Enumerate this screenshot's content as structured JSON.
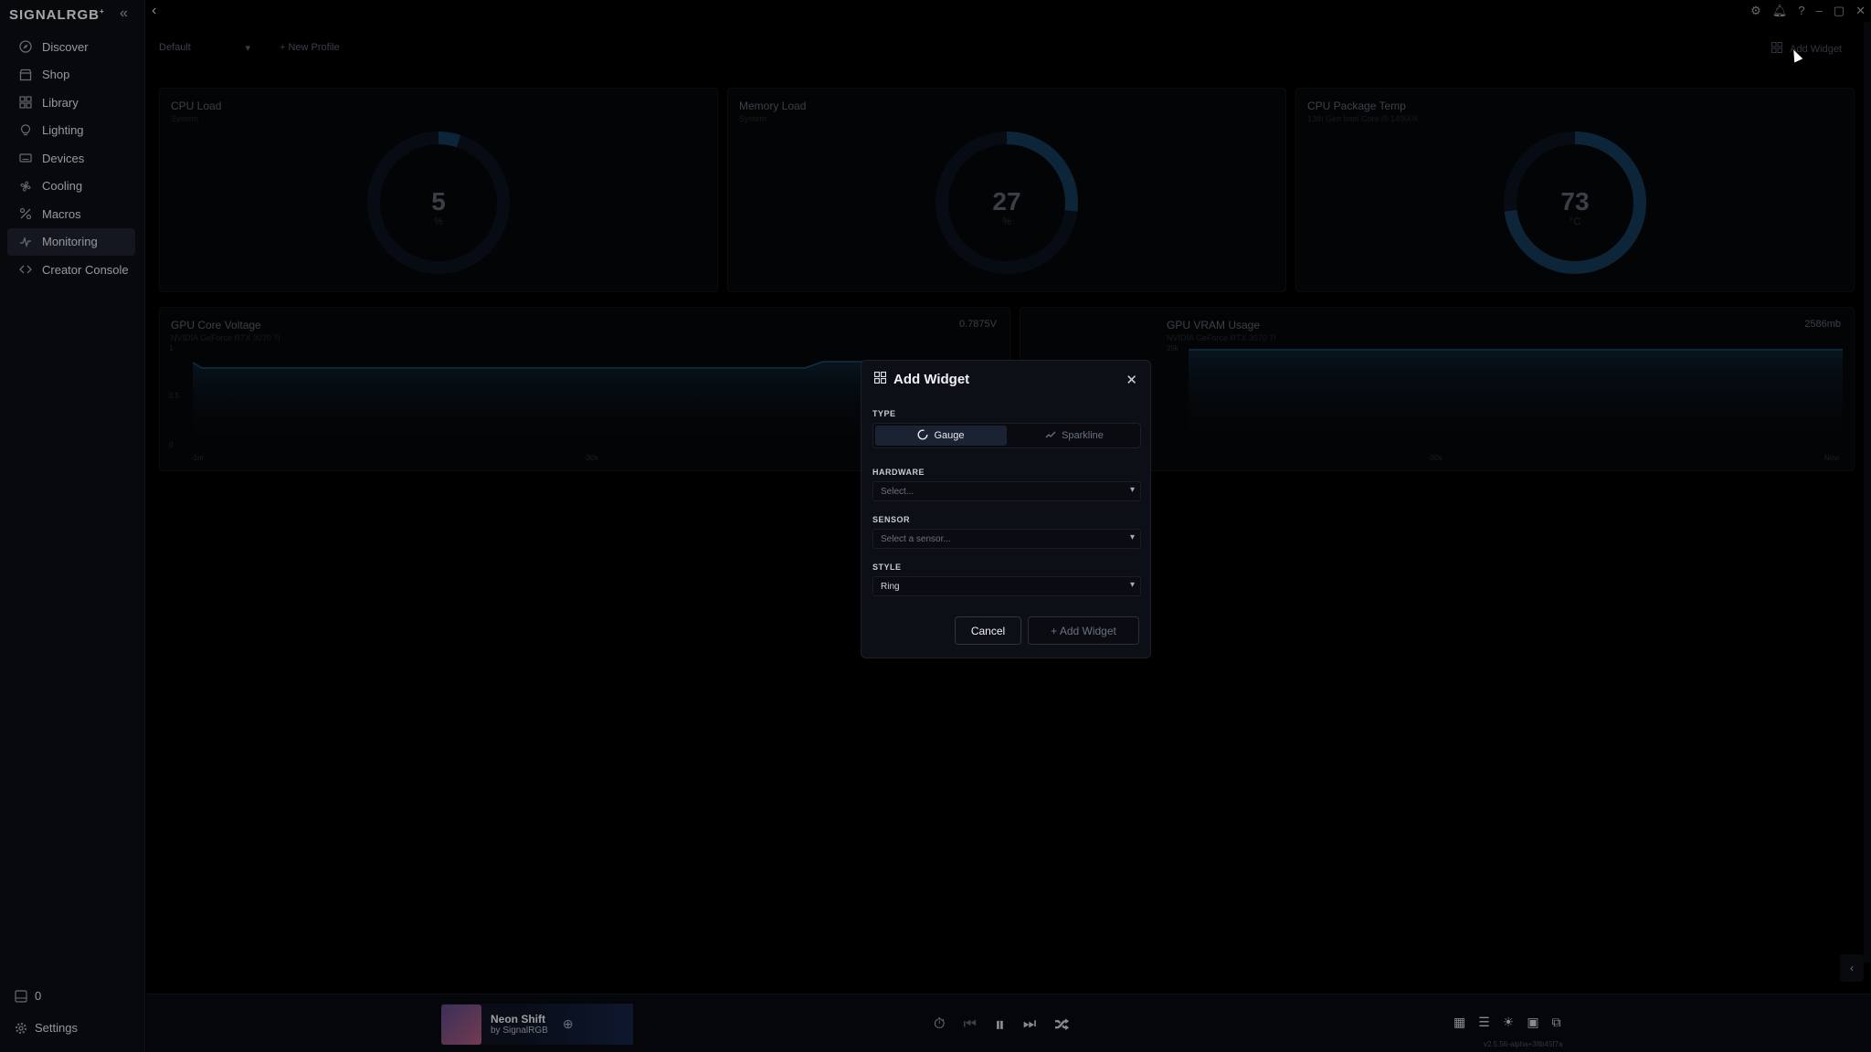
{
  "sidebar": {
    "logo": "SIGNALRGB",
    "items": [
      {
        "label": "Discover",
        "icon": "compass-icon"
      },
      {
        "label": "Shop",
        "icon": "shop-icon"
      },
      {
        "label": "Library",
        "icon": "grid-icon"
      },
      {
        "label": "Lighting",
        "icon": "bulb-icon"
      },
      {
        "label": "Devices",
        "icon": "keyboard-icon"
      },
      {
        "label": "Cooling",
        "icon": "fan-icon"
      },
      {
        "label": "Macros",
        "icon": "macro-icon"
      },
      {
        "label": "Monitoring",
        "icon": "pulse-icon",
        "active": true
      },
      {
        "label": "Creator Console",
        "icon": "code-icon"
      }
    ],
    "counter": "0",
    "settings_label": "Settings"
  },
  "toolbar": {
    "profile": "Default",
    "new_profile": "+ New Profile",
    "add_widget": "Add Widget"
  },
  "widgets": {
    "cpu_load": {
      "title": "CPU Load",
      "subtitle": "System",
      "value": "5",
      "unit": "%",
      "fraction": 0.05
    },
    "memory_load": {
      "title": "Memory Load",
      "subtitle": "System",
      "value": "27",
      "unit": "%",
      "fraction": 0.27
    },
    "cpu_temp": {
      "title": "CPU Package Temp",
      "subtitle": "13th Gen Intel Core i9-14900K",
      "value": "73",
      "unit": "°C",
      "fraction": 0.73
    },
    "gpu_voltage": {
      "title": "GPU Core Voltage",
      "subtitle": "NVIDIA GeForce RTX 3070 Ti",
      "value": "0.7875V",
      "y_ticks": [
        "1",
        "0.5",
        "0"
      ],
      "x_ticks": [
        "-1m",
        "-30s"
      ]
    },
    "gpu_vram": {
      "title": "GPU VRAM Usage",
      "subtitle": "NVIDIA GeForce RTX 3070 Ti",
      "value": "2586mb",
      "y_ticks": [
        "25k"
      ],
      "x_ticks": [
        "-30s",
        "Now"
      ]
    }
  },
  "modal": {
    "title": "Add Widget",
    "type_label": "TYPE",
    "type_options": [
      {
        "label": "Gauge",
        "selected": true
      },
      {
        "label": "Sparkline",
        "selected": false
      }
    ],
    "hardware_label": "HARDWARE",
    "hardware_placeholder": "Select...",
    "sensor_label": "SENSOR",
    "sensor_placeholder": "Select a sensor...",
    "style_label": "STYLE",
    "style_value": "Ring",
    "cancel_label": "Cancel",
    "add_label": "+ Add Widget"
  },
  "player": {
    "track": "Neon Shift",
    "artist": "by SignalRGB",
    "version": "v2.5.56-alpha+38b45f7a"
  }
}
